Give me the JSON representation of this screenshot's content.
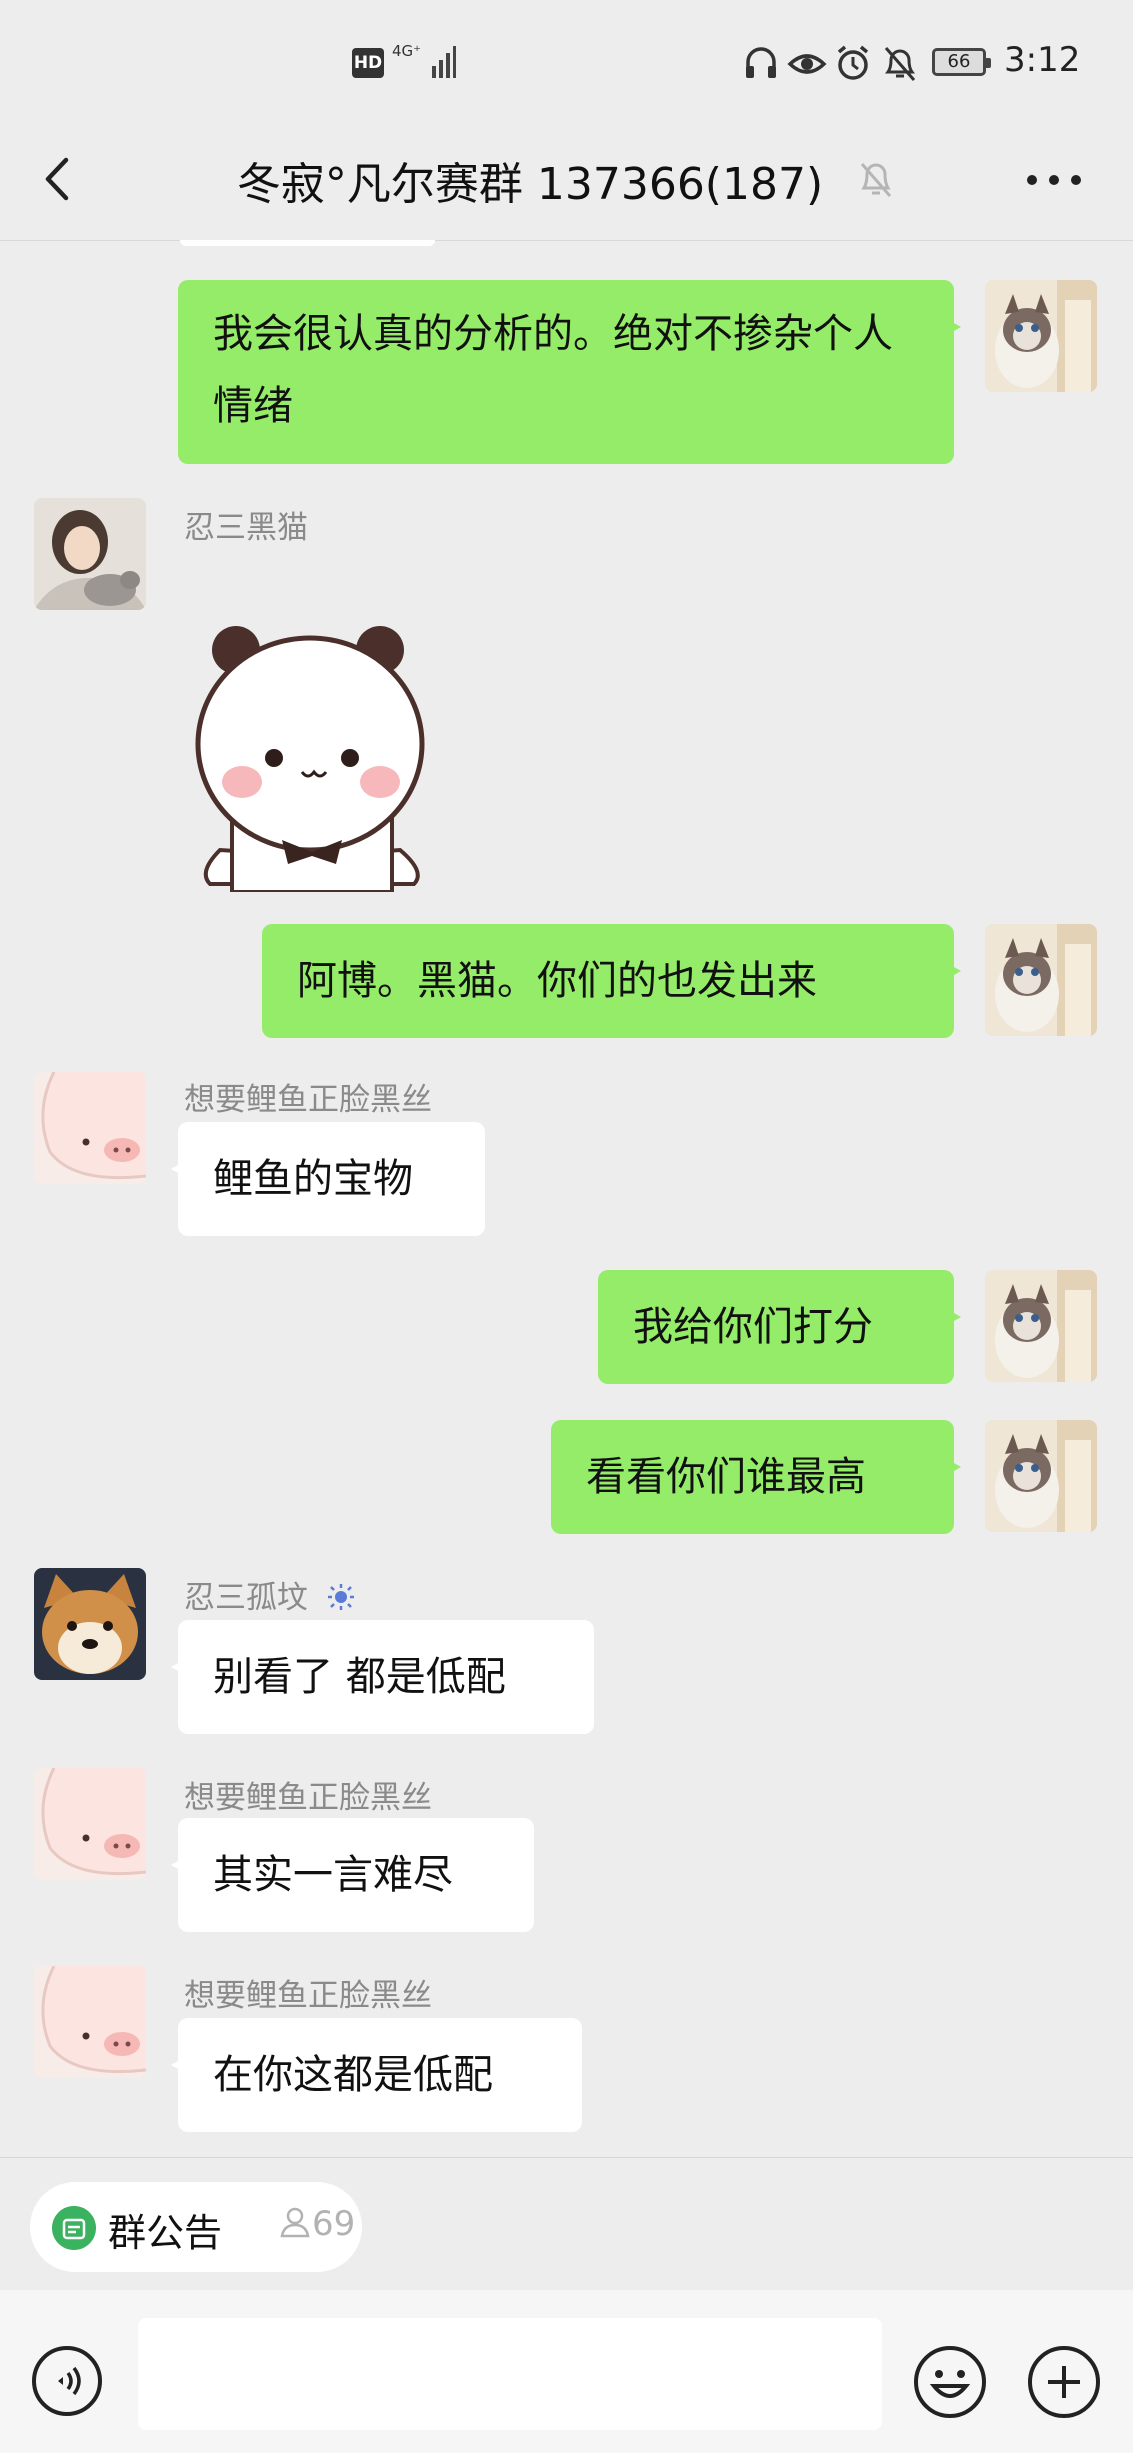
{
  "status_bar": {
    "hd_label": "HD",
    "network_label": "4G⁺",
    "battery_level": "66",
    "time": "3:12"
  },
  "nav": {
    "title": "冬寂°凡尔赛群 137366(187)",
    "back_icon": "chevron-left-icon",
    "mute_icon": "bell-off-icon",
    "more_icon": "more-dots-icon"
  },
  "messages": [
    {
      "side": "me",
      "text": "我会很认真的分析的。绝对不掺杂个人情绪",
      "avatar": "cat-avatar"
    },
    {
      "side": "them",
      "sender": "忍三黑猫",
      "sticker": "panda-bear-sticker",
      "avatar": "girl-with-cat-avatar"
    },
    {
      "side": "me",
      "text": "阿博。黑猫。你们的也发出来",
      "avatar": "cat-avatar"
    },
    {
      "side": "them",
      "sender": "想要鲤鱼正脸黑丝",
      "text": "鲤鱼的宝物",
      "avatar": "pink-pig-avatar"
    },
    {
      "side": "me",
      "text": "我给你们打分",
      "avatar": "cat-avatar"
    },
    {
      "side": "me",
      "text": "看看你们谁最高",
      "avatar": "cat-avatar"
    },
    {
      "side": "them",
      "sender": "忍三孤坟",
      "sender_badge": "sun-icon",
      "text": "别看了 都是低配",
      "avatar": "shiba-dog-avatar"
    },
    {
      "side": "them",
      "sender": "想要鲤鱼正脸黑丝",
      "text": "其实一言难尽",
      "avatar": "pink-pig-avatar"
    },
    {
      "side": "them",
      "sender": "想要鲤鱼正脸黑丝",
      "text": "在你这都是低配",
      "avatar": "pink-pig-avatar"
    }
  ],
  "announcement": {
    "label": "群公告",
    "count": "69"
  },
  "input": {
    "placeholder": ""
  },
  "colors": {
    "my_bubble": "#95ec69",
    "their_bubble": "#ffffff",
    "background": "#ededed",
    "announce_icon": "#3bb25f"
  }
}
